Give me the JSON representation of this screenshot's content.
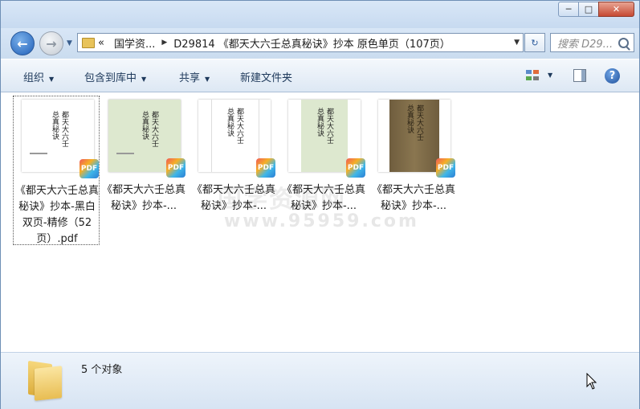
{
  "window": {
    "minimize_glyph": "─",
    "maximize_glyph": "□",
    "close_glyph": "✕"
  },
  "nav": {
    "back_glyph": "←",
    "forward_glyph": "→",
    "dropdown_glyph": "▼",
    "breadcrumb": [
      {
        "label": "«"
      },
      {
        "label": "国学资..."
      },
      {
        "label": "D29814 《都天大六壬总真秘诀》抄本 原色单页（107页）"
      }
    ],
    "refresh_glyph": "↻",
    "search_placeholder": "搜索 D29..."
  },
  "toolbar": {
    "organize": "组织",
    "include_in_library": "包含到库中",
    "share": "共享",
    "new_folder": "新建文件夹",
    "help": "?"
  },
  "watermark": {
    "line1": "国学资源网",
    "line2": "www.95959.com"
  },
  "files": [
    {
      "label": "《都天大六壬总真秘诀》抄本-黑白双页-精修（52页）.pdf",
      "badge": "PDF",
      "thumb_style": "white",
      "selected": true
    },
    {
      "label": "《都天大六壬总真秘诀》抄本-...",
      "badge": "PDF",
      "thumb_style": "green",
      "selected": false
    },
    {
      "label": "《都天大六壬总真秘诀》抄本-...",
      "badge": "PDF",
      "thumb_style": "white-single",
      "selected": false
    },
    {
      "label": "《都天大六壬总真秘诀》抄本-...",
      "badge": "PDF",
      "thumb_style": "green-single",
      "selected": false
    },
    {
      "label": "《都天大六壬总真秘诀》抄本-...",
      "badge": "PDF",
      "thumb_style": "brown",
      "selected": false
    }
  ],
  "thumb_text": {
    "title_col1": "都天大六壬",
    "title_col2": "总真秘诀"
  },
  "status": {
    "count_text": "5 个对象"
  },
  "colors": {
    "pdf_badge": "#2d7fd4",
    "thumb_green": "#dde8cf",
    "thumb_brown": "#7d6a48",
    "frame": "#d7e5f5"
  }
}
